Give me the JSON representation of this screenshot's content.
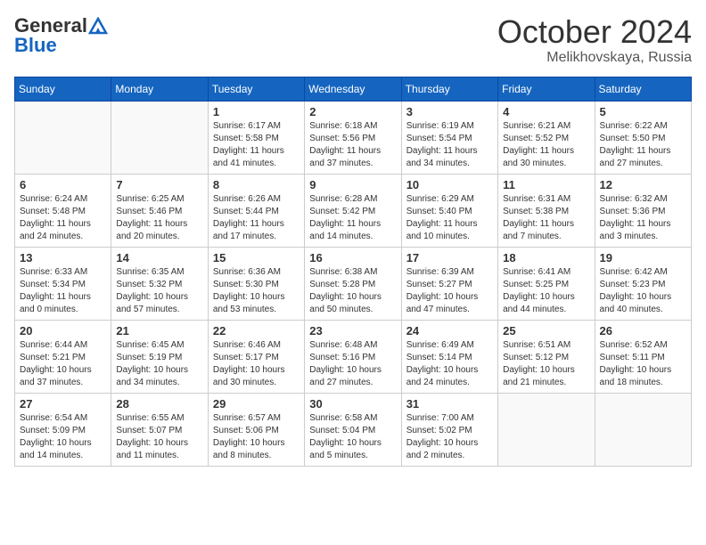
{
  "header": {
    "logo_general": "General",
    "logo_blue": "Blue",
    "month_title": "October 2024",
    "location": "Melikhovskaya, Russia"
  },
  "weekdays": [
    "Sunday",
    "Monday",
    "Tuesday",
    "Wednesday",
    "Thursday",
    "Friday",
    "Saturday"
  ],
  "weeks": [
    [
      {
        "day": "",
        "sunrise": "",
        "sunset": "",
        "daylight": ""
      },
      {
        "day": "",
        "sunrise": "",
        "sunset": "",
        "daylight": ""
      },
      {
        "day": "1",
        "sunrise": "Sunrise: 6:17 AM",
        "sunset": "Sunset: 5:58 PM",
        "daylight": "Daylight: 11 hours and 41 minutes."
      },
      {
        "day": "2",
        "sunrise": "Sunrise: 6:18 AM",
        "sunset": "Sunset: 5:56 PM",
        "daylight": "Daylight: 11 hours and 37 minutes."
      },
      {
        "day": "3",
        "sunrise": "Sunrise: 6:19 AM",
        "sunset": "Sunset: 5:54 PM",
        "daylight": "Daylight: 11 hours and 34 minutes."
      },
      {
        "day": "4",
        "sunrise": "Sunrise: 6:21 AM",
        "sunset": "Sunset: 5:52 PM",
        "daylight": "Daylight: 11 hours and 30 minutes."
      },
      {
        "day": "5",
        "sunrise": "Sunrise: 6:22 AM",
        "sunset": "Sunset: 5:50 PM",
        "daylight": "Daylight: 11 hours and 27 minutes."
      }
    ],
    [
      {
        "day": "6",
        "sunrise": "Sunrise: 6:24 AM",
        "sunset": "Sunset: 5:48 PM",
        "daylight": "Daylight: 11 hours and 24 minutes."
      },
      {
        "day": "7",
        "sunrise": "Sunrise: 6:25 AM",
        "sunset": "Sunset: 5:46 PM",
        "daylight": "Daylight: 11 hours and 20 minutes."
      },
      {
        "day": "8",
        "sunrise": "Sunrise: 6:26 AM",
        "sunset": "Sunset: 5:44 PM",
        "daylight": "Daylight: 11 hours and 17 minutes."
      },
      {
        "day": "9",
        "sunrise": "Sunrise: 6:28 AM",
        "sunset": "Sunset: 5:42 PM",
        "daylight": "Daylight: 11 hours and 14 minutes."
      },
      {
        "day": "10",
        "sunrise": "Sunrise: 6:29 AM",
        "sunset": "Sunset: 5:40 PM",
        "daylight": "Daylight: 11 hours and 10 minutes."
      },
      {
        "day": "11",
        "sunrise": "Sunrise: 6:31 AM",
        "sunset": "Sunset: 5:38 PM",
        "daylight": "Daylight: 11 hours and 7 minutes."
      },
      {
        "day": "12",
        "sunrise": "Sunrise: 6:32 AM",
        "sunset": "Sunset: 5:36 PM",
        "daylight": "Daylight: 11 hours and 3 minutes."
      }
    ],
    [
      {
        "day": "13",
        "sunrise": "Sunrise: 6:33 AM",
        "sunset": "Sunset: 5:34 PM",
        "daylight": "Daylight: 11 hours and 0 minutes."
      },
      {
        "day": "14",
        "sunrise": "Sunrise: 6:35 AM",
        "sunset": "Sunset: 5:32 PM",
        "daylight": "Daylight: 10 hours and 57 minutes."
      },
      {
        "day": "15",
        "sunrise": "Sunrise: 6:36 AM",
        "sunset": "Sunset: 5:30 PM",
        "daylight": "Daylight: 10 hours and 53 minutes."
      },
      {
        "day": "16",
        "sunrise": "Sunrise: 6:38 AM",
        "sunset": "Sunset: 5:28 PM",
        "daylight": "Daylight: 10 hours and 50 minutes."
      },
      {
        "day": "17",
        "sunrise": "Sunrise: 6:39 AM",
        "sunset": "Sunset: 5:27 PM",
        "daylight": "Daylight: 10 hours and 47 minutes."
      },
      {
        "day": "18",
        "sunrise": "Sunrise: 6:41 AM",
        "sunset": "Sunset: 5:25 PM",
        "daylight": "Daylight: 10 hours and 44 minutes."
      },
      {
        "day": "19",
        "sunrise": "Sunrise: 6:42 AM",
        "sunset": "Sunset: 5:23 PM",
        "daylight": "Daylight: 10 hours and 40 minutes."
      }
    ],
    [
      {
        "day": "20",
        "sunrise": "Sunrise: 6:44 AM",
        "sunset": "Sunset: 5:21 PM",
        "daylight": "Daylight: 10 hours and 37 minutes."
      },
      {
        "day": "21",
        "sunrise": "Sunrise: 6:45 AM",
        "sunset": "Sunset: 5:19 PM",
        "daylight": "Daylight: 10 hours and 34 minutes."
      },
      {
        "day": "22",
        "sunrise": "Sunrise: 6:46 AM",
        "sunset": "Sunset: 5:17 PM",
        "daylight": "Daylight: 10 hours and 30 minutes."
      },
      {
        "day": "23",
        "sunrise": "Sunrise: 6:48 AM",
        "sunset": "Sunset: 5:16 PM",
        "daylight": "Daylight: 10 hours and 27 minutes."
      },
      {
        "day": "24",
        "sunrise": "Sunrise: 6:49 AM",
        "sunset": "Sunset: 5:14 PM",
        "daylight": "Daylight: 10 hours and 24 minutes."
      },
      {
        "day": "25",
        "sunrise": "Sunrise: 6:51 AM",
        "sunset": "Sunset: 5:12 PM",
        "daylight": "Daylight: 10 hours and 21 minutes."
      },
      {
        "day": "26",
        "sunrise": "Sunrise: 6:52 AM",
        "sunset": "Sunset: 5:11 PM",
        "daylight": "Daylight: 10 hours and 18 minutes."
      }
    ],
    [
      {
        "day": "27",
        "sunrise": "Sunrise: 6:54 AM",
        "sunset": "Sunset: 5:09 PM",
        "daylight": "Daylight: 10 hours and 14 minutes."
      },
      {
        "day": "28",
        "sunrise": "Sunrise: 6:55 AM",
        "sunset": "Sunset: 5:07 PM",
        "daylight": "Daylight: 10 hours and 11 minutes."
      },
      {
        "day": "29",
        "sunrise": "Sunrise: 6:57 AM",
        "sunset": "Sunset: 5:06 PM",
        "daylight": "Daylight: 10 hours and 8 minutes."
      },
      {
        "day": "30",
        "sunrise": "Sunrise: 6:58 AM",
        "sunset": "Sunset: 5:04 PM",
        "daylight": "Daylight: 10 hours and 5 minutes."
      },
      {
        "day": "31",
        "sunrise": "Sunrise: 7:00 AM",
        "sunset": "Sunset: 5:02 PM",
        "daylight": "Daylight: 10 hours and 2 minutes."
      },
      {
        "day": "",
        "sunrise": "",
        "sunset": "",
        "daylight": ""
      },
      {
        "day": "",
        "sunrise": "",
        "sunset": "",
        "daylight": ""
      }
    ]
  ]
}
